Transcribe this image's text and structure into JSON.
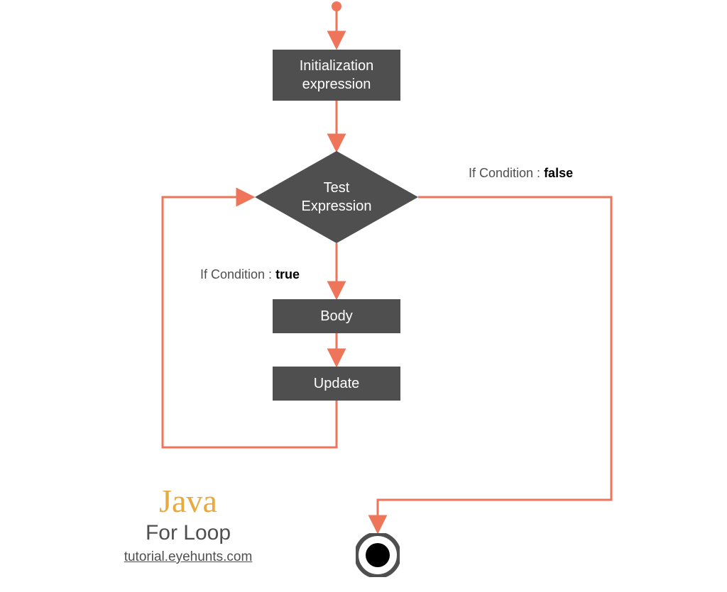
{
  "nodes": {
    "init": "Initialization\nexpression",
    "test": "Test\nExpression",
    "body": "Body",
    "update": "Update"
  },
  "labels": {
    "true_prefix": "If Condition : ",
    "true_value": "true",
    "false_prefix": "If Condition : ",
    "false_value": "false"
  },
  "title": {
    "main": "Java",
    "sub": "For Loop",
    "site": "tutorial.eyehunts.com"
  },
  "colors": {
    "arrow": "#ee7559",
    "box": "#4f4f4f"
  }
}
